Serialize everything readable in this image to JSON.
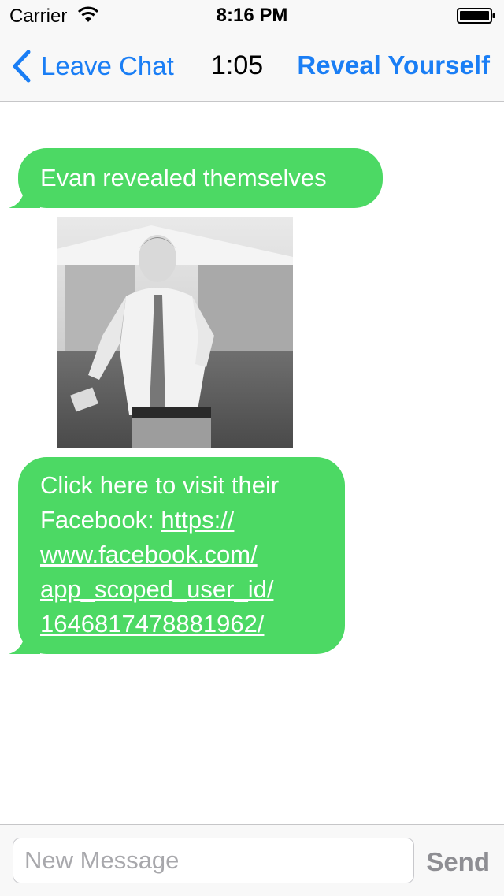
{
  "status_bar": {
    "carrier": "Carrier",
    "time": "8:16 PM",
    "wifi_icon": "wifi-icon",
    "battery_icon": "battery-icon"
  },
  "nav": {
    "back_label": "Leave Chat",
    "back_icon": "chevron-left-icon",
    "timer": "1:05",
    "reveal_label": "Reveal Yourself"
  },
  "messages": [
    {
      "text": "Evan revealed themselves"
    },
    {
      "photo": "photo of a person juggling outdoors (black & white)"
    },
    {
      "text_prefix": "Click here to visit their Facebook: ",
      "link": "https://www.facebook.com/app_scoped_user_id/1646817478881962/",
      "display_lines": [
        "Click here to visit their",
        "Facebook: ",
        "https://",
        "www.facebook.com/",
        "app_scoped_user_id/",
        "1646817478881962/"
      ]
    }
  ],
  "composer": {
    "placeholder": "New Message",
    "value": "",
    "send_label": "Send"
  },
  "colors": {
    "accent": "#1a7ef5",
    "bubble": "#4cd964",
    "send_disabled": "#8e8e93"
  }
}
